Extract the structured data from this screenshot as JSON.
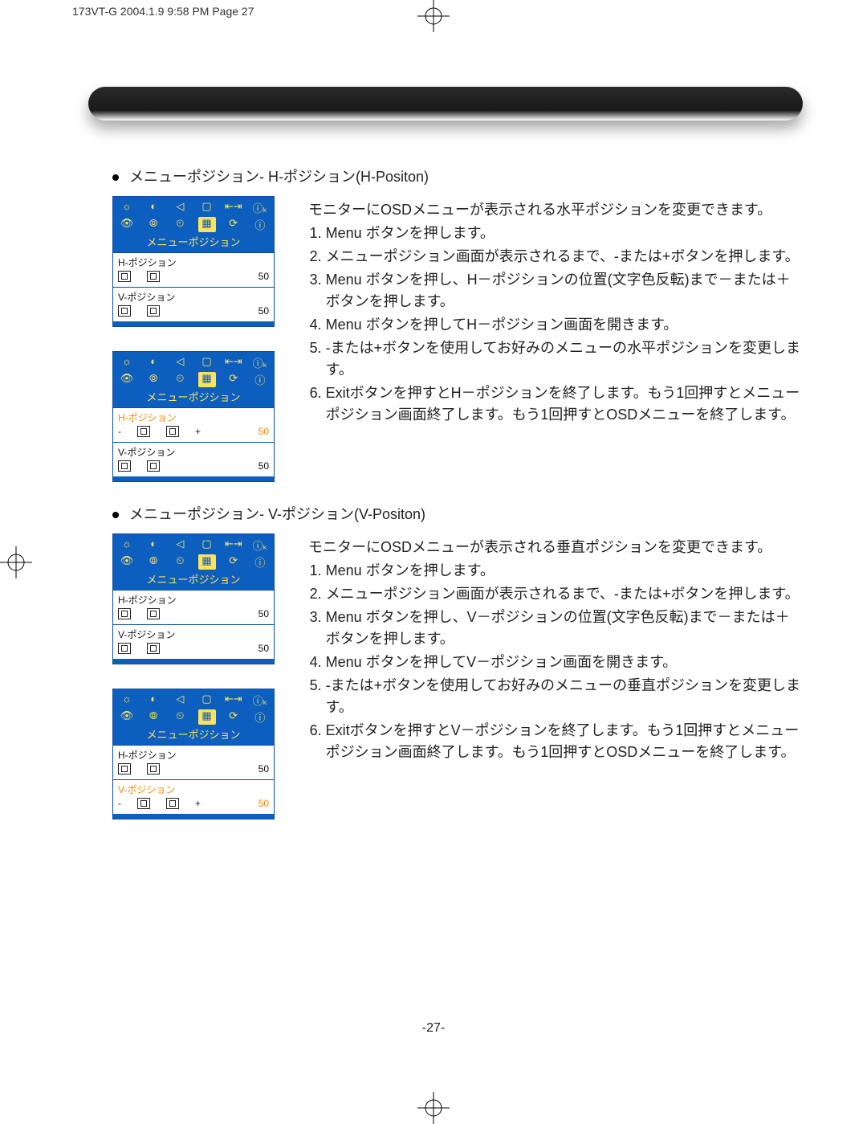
{
  "header_mark": "173VT-G  2004.1.9 9:58 PM  Page 27",
  "page_number": "-27-",
  "sections": [
    {
      "title": "メニューポジション- H-ポジション(H-Positon)",
      "intro": "モニターにOSDメニューが表示される水平ポジションを変更できます。",
      "steps": [
        "Menu  ボタンを押します。",
        "メニューポジション画面が表示されるまで、-または+ボタンを押します。",
        "Menu  ボタンを押し、H－ポジションの位置(文字色反転)まで－または＋ボタンを押します。",
        "Menu  ボタンを押してH－ポジション画面を開きます。",
        "-または+ボタンを使用してお好みのメニューの水平ポジションを変更します。",
        "Exitボタンを押すとH－ポジションを終了します。もう1回押すとメニューポジション画面終了します。もう1回押すとOSDメニューを終了します。"
      ],
      "osd_panels": [
        {
          "menu_title": "メニューポジション",
          "items": [
            {
              "label": "H-ポジション",
              "value": "50",
              "highlighted": false,
              "signs": false
            },
            {
              "label": "V-ポジション",
              "value": "50",
              "highlighted": false,
              "signs": false
            }
          ]
        },
        {
          "menu_title": "メニューポジション",
          "items": [
            {
              "label": "H-ポジション",
              "value": "50",
              "highlighted": true,
              "signs": true
            },
            {
              "label": "V-ポジション",
              "value": "50",
              "highlighted": false,
              "signs": false
            }
          ]
        }
      ]
    },
    {
      "title": "メニューポジション- V-ポジション(V-Positon)",
      "intro": "モニターにOSDメニューが表示される垂直ポジションを変更できます。",
      "steps": [
        "Menu  ボタンを押します。",
        "メニューポジション画面が表示されるまで、-または+ボタンを押します。",
        "Menu  ボタンを押し、V－ポジションの位置(文字色反転)まで－または＋ボタンを押します。",
        "Menu  ボタンを押してV－ポジション画面を開きます。",
        "-または+ボタンを使用してお好みのメニューの垂直ポジションを変更します。",
        "Exitボタンを押すとV－ポジションを終了します。もう1回押すとメニューポジション画面終了します。もう1回押すとOSDメニューを終了します。"
      ],
      "osd_panels": [
        {
          "menu_title": "メニューポジション",
          "items": [
            {
              "label": "H-ポジション",
              "value": "50",
              "highlighted": false,
              "signs": false
            },
            {
              "label": "V-ポジション",
              "value": "50",
              "highlighted": false,
              "signs": false
            }
          ]
        },
        {
          "menu_title": "メニューポジション",
          "items": [
            {
              "label": "H-ポジション",
              "value": "50",
              "highlighted": false,
              "signs": false
            },
            {
              "label": "V-ポジション",
              "value": "50",
              "highlighted": true,
              "signs": true
            }
          ]
        }
      ]
    }
  ],
  "osd_icons_row1": [
    "☼",
    "◐",
    "◁",
    "▢",
    "⇤⇥",
    "ⓘₖ"
  ],
  "osd_icons_row2": [
    "👁",
    "⦾",
    "⏲",
    "▦",
    "⟳",
    "ⓘ"
  ]
}
